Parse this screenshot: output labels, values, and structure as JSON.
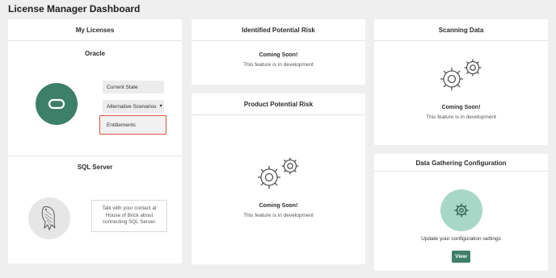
{
  "page_title": "License Manager Dashboard",
  "my_licenses": {
    "title": "My Licenses",
    "oracle": {
      "title": "Oracle",
      "buttons": {
        "current_state": "Current State",
        "alternative_scenarios": "Alternative Scenarios",
        "entitlements": "Entitlements"
      }
    },
    "sql_server": {
      "title": "SQL Server",
      "message": "Talk with your contact at House of Brick about connecting SQL Server."
    }
  },
  "identified_risk": {
    "title": "Identified Potential Risk",
    "coming_soon": "Coming Soon!",
    "description": "This feature is in development"
  },
  "product_risk": {
    "title": "Product Potential Risk",
    "coming_soon": "Coming Soon!",
    "description": "This feature is in development"
  },
  "scanning": {
    "title": "Scanning Data",
    "coming_soon": "Coming Soon!",
    "description": "This feature is in development"
  },
  "config": {
    "title": "Data Gathering Configuration",
    "description": "Update your configuration settings",
    "view_label": "View"
  },
  "colors": {
    "accent": "#3e7f6a",
    "accent_light": "#a8d7c7",
    "highlight": "#d9573e"
  },
  "icons": [
    "oracle-icon",
    "caret-down-icon",
    "mysql-dolphin-icon",
    "gears-icon",
    "gear-icon"
  ]
}
